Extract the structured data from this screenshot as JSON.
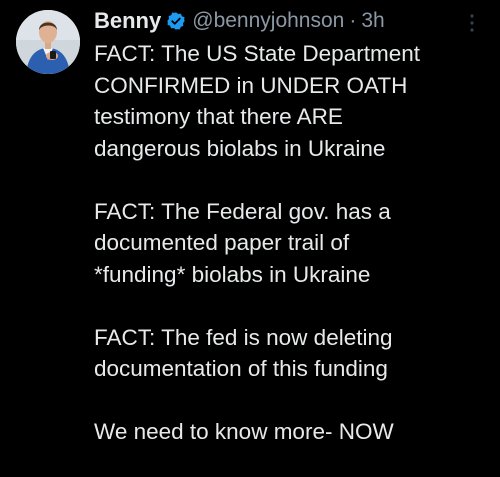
{
  "tweet": {
    "author_name": "Benny",
    "handle": "@bennyjohnson",
    "separator": "·",
    "time": "3h",
    "paragraphs": [
      "FACT: The US State Department\nCONFIRMED in UNDER OATH\ntestimony that there ARE\ndangerous biolabs in Ukraine",
      "FACT: The Federal gov. has a\ndocumented paper trail of\n*funding* biolabs in Ukraine",
      "FACT: The fed is now deleting\ndocumentation of this funding",
      "We need to know more- NOW"
    ]
  },
  "icons": {
    "verified": "verified-badge-icon",
    "more": "more-options-icon"
  },
  "colors": {
    "background": "#000000",
    "text": "#e7e9ea",
    "secondary_text": "#8b98a5",
    "verified": "#1d9bf0"
  }
}
